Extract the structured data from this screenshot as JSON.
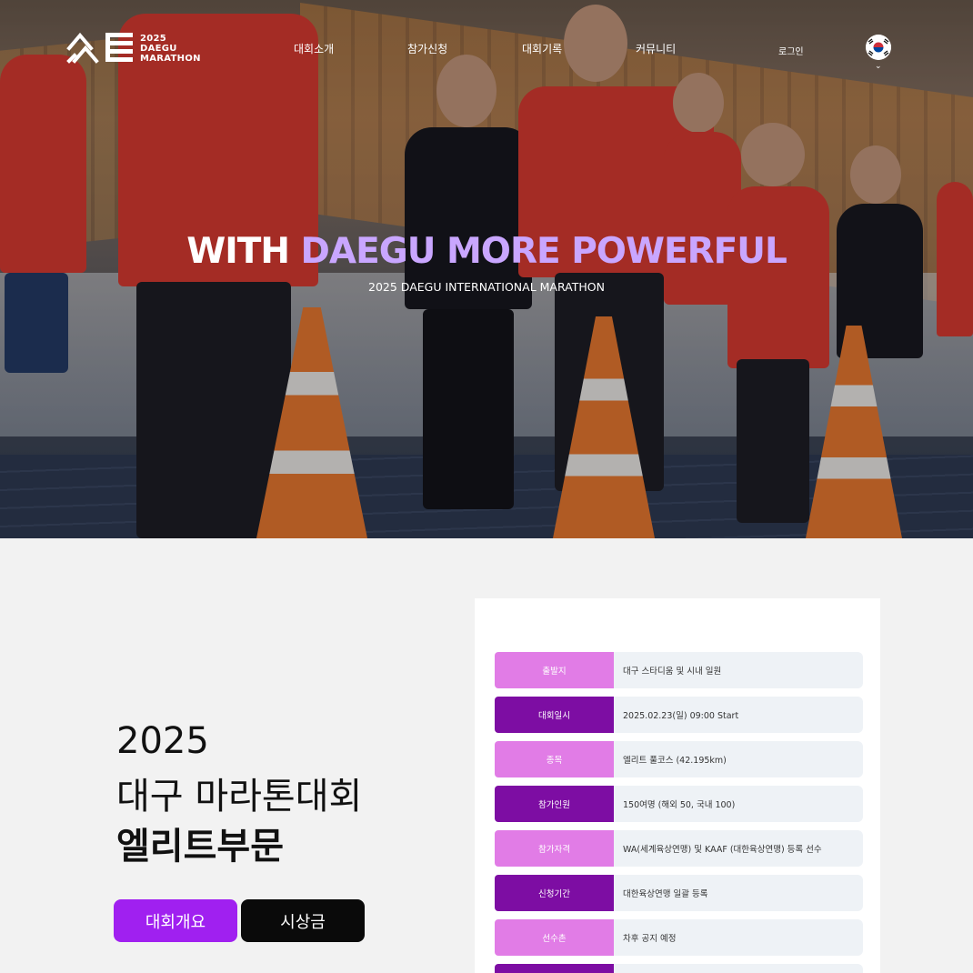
{
  "brand": {
    "year": "2025",
    "line1": "DAEGU",
    "line2": "MARATHON"
  },
  "nav": {
    "items": [
      "대회소개",
      "참가신청",
      "대회기록",
      "커뮤니티"
    ],
    "login": "로그인"
  },
  "hero": {
    "title_white": "WITH ",
    "title_purple": "DAEGU MORE POWERFUL",
    "subtitle": "2025 DAEGU INTERNATIONAL MARATHON"
  },
  "intro": {
    "year": "2025",
    "event_name": "대구 마라톤대회",
    "division": "엘리트부문"
  },
  "buttons": {
    "overview": "대회개요",
    "prize": "시상금"
  },
  "info": [
    {
      "label": "출발지",
      "value": "대구 스타디움 및 시내 일원"
    },
    {
      "label": "대회일시",
      "value": "2025.02.23(일) 09:00 Start"
    },
    {
      "label": "종목",
      "value": "엘리트 풀코스 (42.195km)"
    },
    {
      "label": "참가인원",
      "value": "150여명 (해외 50, 국내 100)"
    },
    {
      "label": "참가자격",
      "value": "WA(세계육상연맹) 및 KAAF (대한육상연맹) 등록 선수"
    },
    {
      "label": "신청기간",
      "value": "대한육상연맹 일괄 등록"
    },
    {
      "label": "선수촌",
      "value": "차후 공지 예정"
    },
    {
      "label": "",
      "value": ""
    }
  ],
  "colors": {
    "accent": "#a020f0",
    "label_light": "#e17ce6",
    "label_dark": "#7d0da3",
    "hero_highlight": "#c9a6ff"
  }
}
